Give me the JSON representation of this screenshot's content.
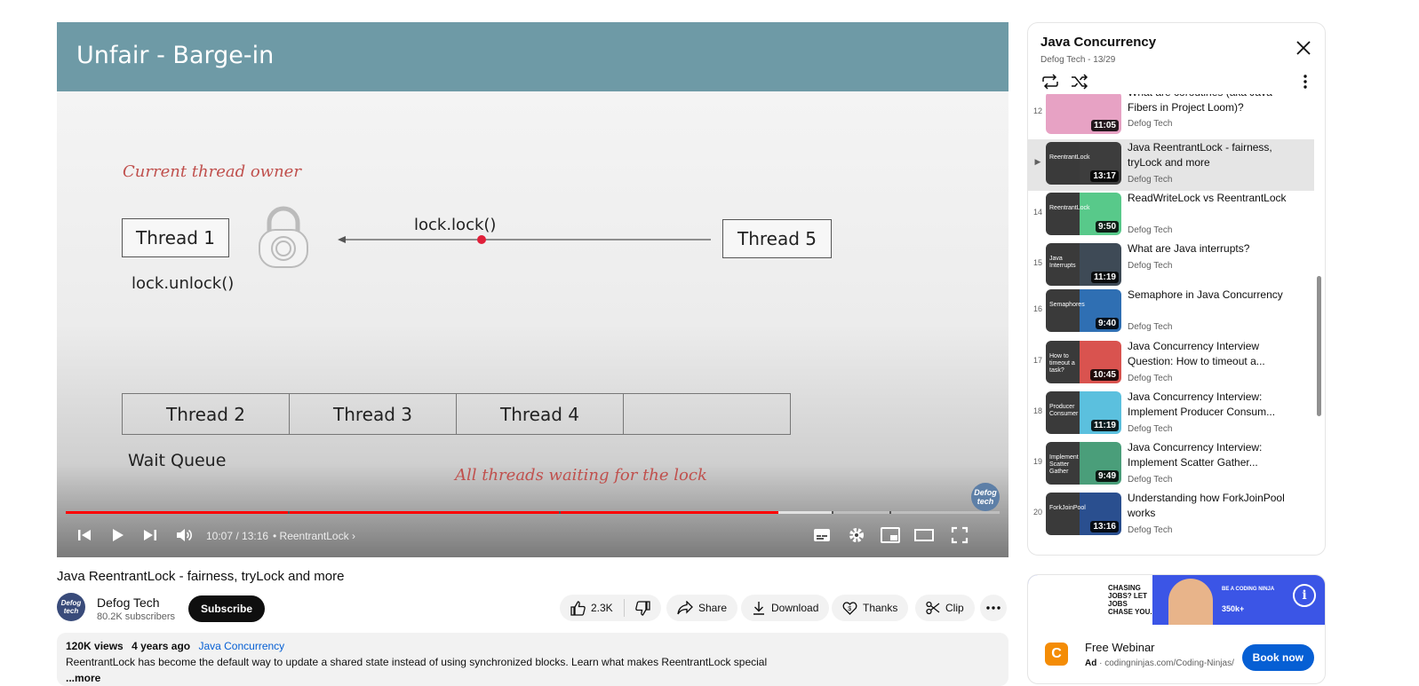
{
  "slide": {
    "title": "Unfair - Barge-in",
    "owner_caption": "Current thread owner",
    "owner_thread": "Thread 1",
    "unlock_call": "lock.unlock()",
    "lock_call": "lock.lock()",
    "incoming_thread": "Thread 5",
    "queue": [
      "Thread 2",
      "Thread 3",
      "Thread 4",
      ""
    ],
    "queue_label": "Wait Queue",
    "queue_caption": "All threads waiting for the lock",
    "watermark": "Defog tech"
  },
  "player": {
    "time": "10:07 / 13:16",
    "chapter": "• ReentrantLock",
    "progress": 0.763,
    "buffered": 0.82,
    "chapter_marks": [
      0.238,
      0.528,
      0.82,
      0.882
    ]
  },
  "video": {
    "title": "Java ReentrantLock - fairness, tryLock and more",
    "channel": "Defog Tech",
    "avatar_text": "Defog tech",
    "subscribers": "80.2K subscribers",
    "subscribe_label": "Subscribe",
    "likes": "2.3K",
    "share_label": "Share",
    "download_label": "Download",
    "thanks_label": "Thanks",
    "clip_label": "Clip",
    "views": "120K views",
    "age": "4 years ago",
    "playlist_link": "Java Concurrency",
    "description": "ReentrantLock has become the default way to update a shared state instead of using synchronized blocks. Learn what makes ReentrantLock special",
    "more_label": "...more"
  },
  "playlist": {
    "title": "Java Concurrency",
    "subtitle": "Defog Tech - 13/29",
    "items": [
      {
        "index": "12",
        "title": "What are coroutines (aka Java Fibers in Project Loom)?",
        "channel": "Defog Tech",
        "duration": "11:05",
        "thumb_color": "#e7a2c4",
        "thumb_text": ""
      },
      {
        "index": "▶",
        "title": "Java ReentrantLock - fairness, tryLock and more",
        "channel": "Defog Tech",
        "duration": "13:17",
        "thumb_color": "#3d3d3d",
        "thumb_text": "ReentrantLock"
      },
      {
        "index": "14",
        "title": "ReadWriteLock vs ReentrantLock",
        "channel": "Defog Tech",
        "duration": "9:50",
        "thumb_color": "#58c98a",
        "thumb_text": "ReentrantLock"
      },
      {
        "index": "15",
        "title": "What are Java interrupts?",
        "channel": "Defog Tech",
        "duration": "11:19",
        "thumb_color": "#3e4a56",
        "thumb_text": "Java Interrupts"
      },
      {
        "index": "16",
        "title": "Semaphore in Java Concurrency",
        "channel": "Defog Tech",
        "duration": "9:40",
        "thumb_color": "#2f6fb3",
        "thumb_text": "Semaphores"
      },
      {
        "index": "17",
        "title": "Java Concurrency Interview Question: How to timeout a...",
        "channel": "Defog Tech",
        "duration": "10:45",
        "thumb_color": "#d9534f",
        "thumb_text": "How to timeout a task?"
      },
      {
        "index": "18",
        "title": "Java Concurrency Interview: Implement Producer Consum...",
        "channel": "Defog Tech",
        "duration": "11:19",
        "thumb_color": "#5bc0de",
        "thumb_text": "Producer Consumer"
      },
      {
        "index": "19",
        "title": "Java Concurrency Interview: Implement Scatter Gather...",
        "channel": "Defog Tech",
        "duration": "9:49",
        "thumb_color": "#4a9e7a",
        "thumb_text": "Implement Scatter Gather"
      },
      {
        "index": "20",
        "title": "Understanding how ForkJoinPool works",
        "channel": "Defog Tech",
        "duration": "13:16",
        "thumb_color": "#2a4f8f",
        "thumb_text": "ForkJoinPool"
      }
    ]
  },
  "ad": {
    "banner_left": "CHASING JOBS? LET JOBS CHASE YOU.",
    "banner_right": "BE A CODING NINJA",
    "banner_stat": "350k+",
    "title": "Free Webinar",
    "label": "Ad",
    "domain": "codingninjas.com/Coding-Ninjas/",
    "cta": "Book now",
    "logo_glyph": "C"
  },
  "colors": {
    "accent_red": "#ff0000",
    "slide_header": "#6e9aa6",
    "cta_blue": "#065fd4"
  }
}
